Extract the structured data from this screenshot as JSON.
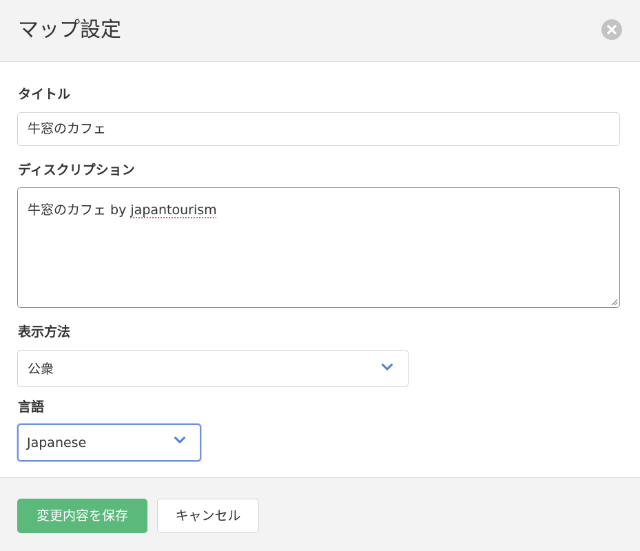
{
  "dialog": {
    "title": "マップ設定"
  },
  "form": {
    "title_label": "タイトル",
    "title_value": "牛窓のカフェ",
    "description_label": "ディスクリプション",
    "description_value_prefix": "牛窓のカフェ by ",
    "description_value_flagged_word": "japantourism",
    "visibility_label": "表示方法",
    "visibility_value": "公衆",
    "language_label": "言語",
    "language_value": "Japanese"
  },
  "footer": {
    "save_label": "変更内容を保存",
    "cancel_label": "キャンセル"
  },
  "colors": {
    "header_bg": "#f3f3f3",
    "save_button": "#5bb97b",
    "chevron": "#4a7fd6",
    "focus_border": "#6f8fe0",
    "spellcheck_underline": "#e04b4b",
    "close_button": "#c3c3c3"
  },
  "icons": {
    "close": "close-icon",
    "chevron": "chevron-down-icon",
    "resize": "resize-grip-icon"
  }
}
